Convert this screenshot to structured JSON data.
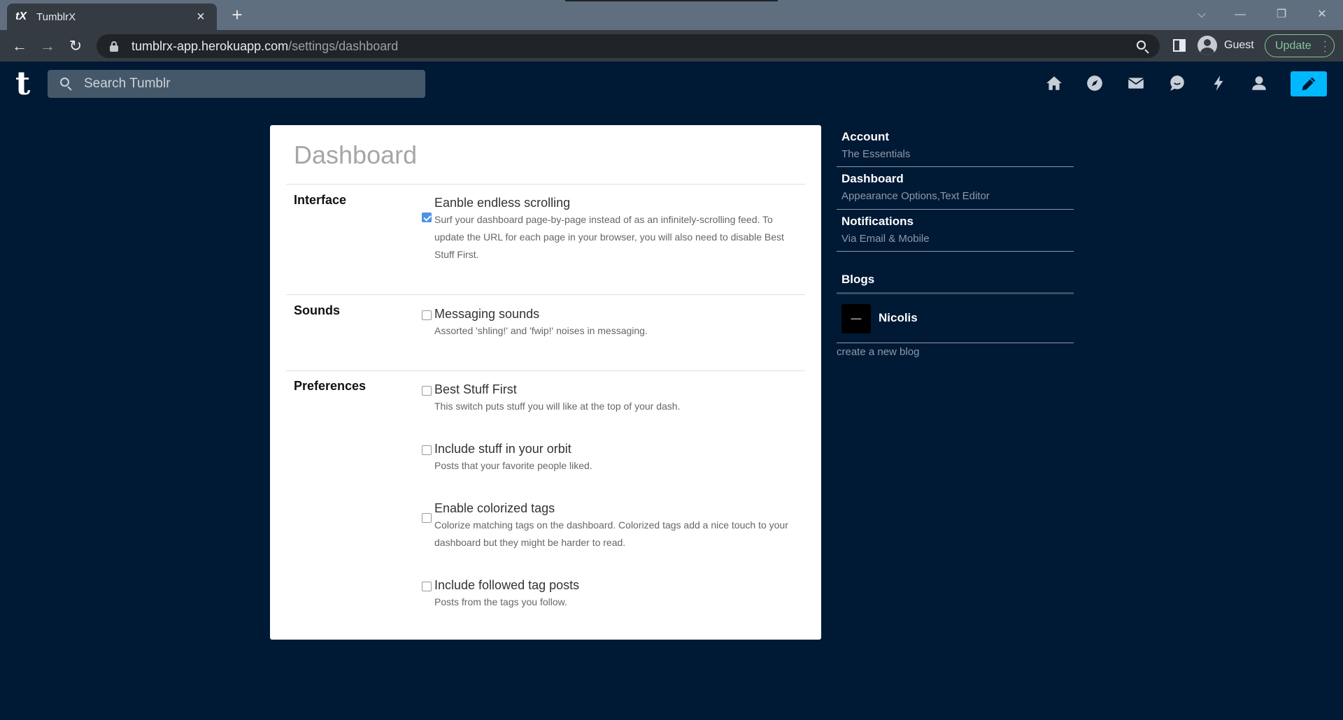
{
  "browser": {
    "tab_title": "TumblrX",
    "tab_favicon": "tX",
    "url_host": "tumblrx-app.herokuapp.com",
    "url_path": "/settings/dashboard",
    "profile_name": "Guest",
    "update_label": "Update"
  },
  "header": {
    "logo": "t",
    "search_placeholder": "Search Tumblr"
  },
  "settings": {
    "title": "Dashboard",
    "sections": [
      {
        "label": "Interface",
        "items": [
          {
            "title": "Eanble endless scrolling",
            "desc": "Surf your dashboard page-by-page instead of as an infinitely-scrolling feed. To update the URL for each page in your browser, you will also need to disable Best Stuff First.",
            "checked": true
          }
        ]
      },
      {
        "label": "Sounds",
        "items": [
          {
            "title": "Messaging sounds",
            "desc": "Assorted 'shling!' and 'fwip!' noises in messaging.",
            "checked": false
          }
        ]
      },
      {
        "label": "Preferences",
        "items": [
          {
            "title": "Best Stuff First",
            "desc": "This switch puts stuff you will like at the top of your dash.",
            "checked": false
          },
          {
            "title": "Include stuff in your orbit",
            "desc": "Posts that your favorite people liked.",
            "checked": false
          },
          {
            "title": "Enable colorized tags",
            "desc": "Colorize matching tags on the dashboard. Colorized tags add a nice touch to your dashboard but they might be harder to read.",
            "checked": false
          },
          {
            "title": "Include followed tag posts",
            "desc": "Posts from the tags you follow.",
            "checked": false
          }
        ]
      }
    ]
  },
  "sidebar": {
    "items": [
      {
        "title": "Account",
        "sub": "The Essentials"
      },
      {
        "title": "Dashboard",
        "sub": "Appearance Options,Text Editor"
      },
      {
        "title": "Notifications",
        "sub": "Via Email & Mobile"
      }
    ],
    "blogs_heading": "Blogs",
    "blog_name": "Nicolis",
    "create_blog": "create a new blog"
  },
  "colors": {
    "background": "#001935",
    "accent": "#00b8ff",
    "checkbox_checked": "#4b93e6"
  },
  "icons": {
    "header": [
      "home-icon",
      "explore-icon",
      "mail-icon",
      "chat-icon",
      "lightning-icon",
      "account-icon",
      "pencil-icon"
    ]
  }
}
